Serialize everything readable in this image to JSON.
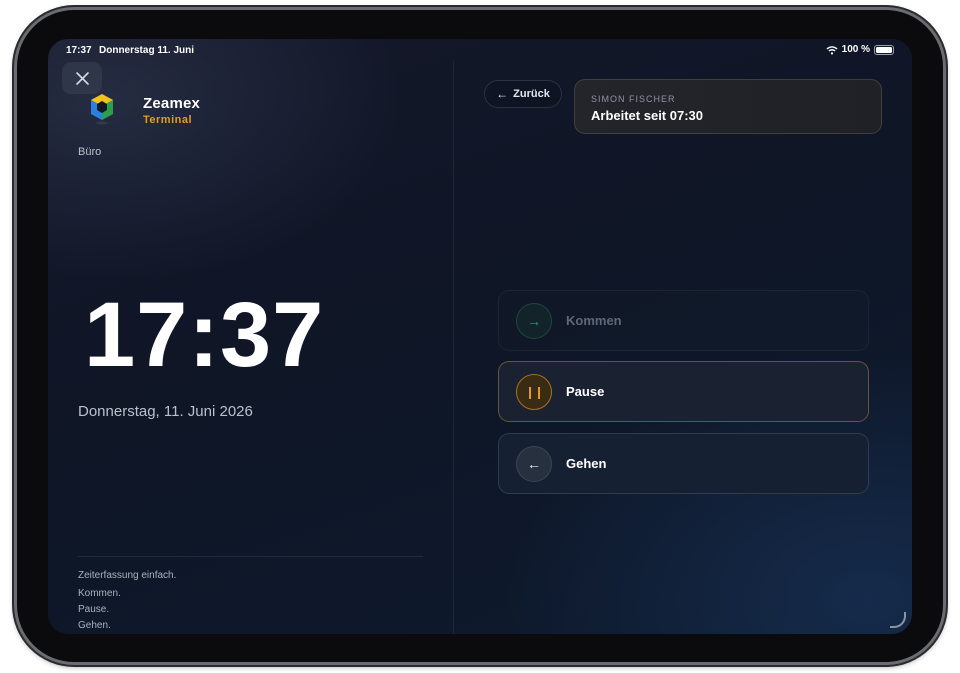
{
  "status_bar": {
    "time": "17:37",
    "date": "Donnerstag 11. Juni",
    "battery": "100 %",
    "icons": [
      "wifi-icon",
      "battery-icon"
    ]
  },
  "header": {
    "close_icon": "close-icon",
    "brand_name": "Zeamex",
    "brand_sub": "Terminal",
    "location": "Büro"
  },
  "clock": {
    "time": "17:37",
    "date": "Donnerstag, 11. Juni 2026"
  },
  "footer": {
    "lines": [
      "Zeiterfassung einfach.",
      "Kommen.",
      "Pause.",
      "Gehen."
    ]
  },
  "nav": {
    "back_label": "Zurück"
  },
  "user": {
    "name": "SIMON FISCHER",
    "status": "Arbeitet seit 07:30"
  },
  "actions": [
    {
      "label": "Kommen",
      "icon": "arrow-right-icon",
      "state": "disabled"
    },
    {
      "label": "Pause",
      "icon": "pause-icon",
      "state": "active"
    },
    {
      "label": "Gehen",
      "icon": "arrow-left-icon",
      "state": "enabled"
    }
  ],
  "colors": {
    "accent": "#e39a2a",
    "success": "#2a9f63",
    "background": "#0f1626"
  }
}
